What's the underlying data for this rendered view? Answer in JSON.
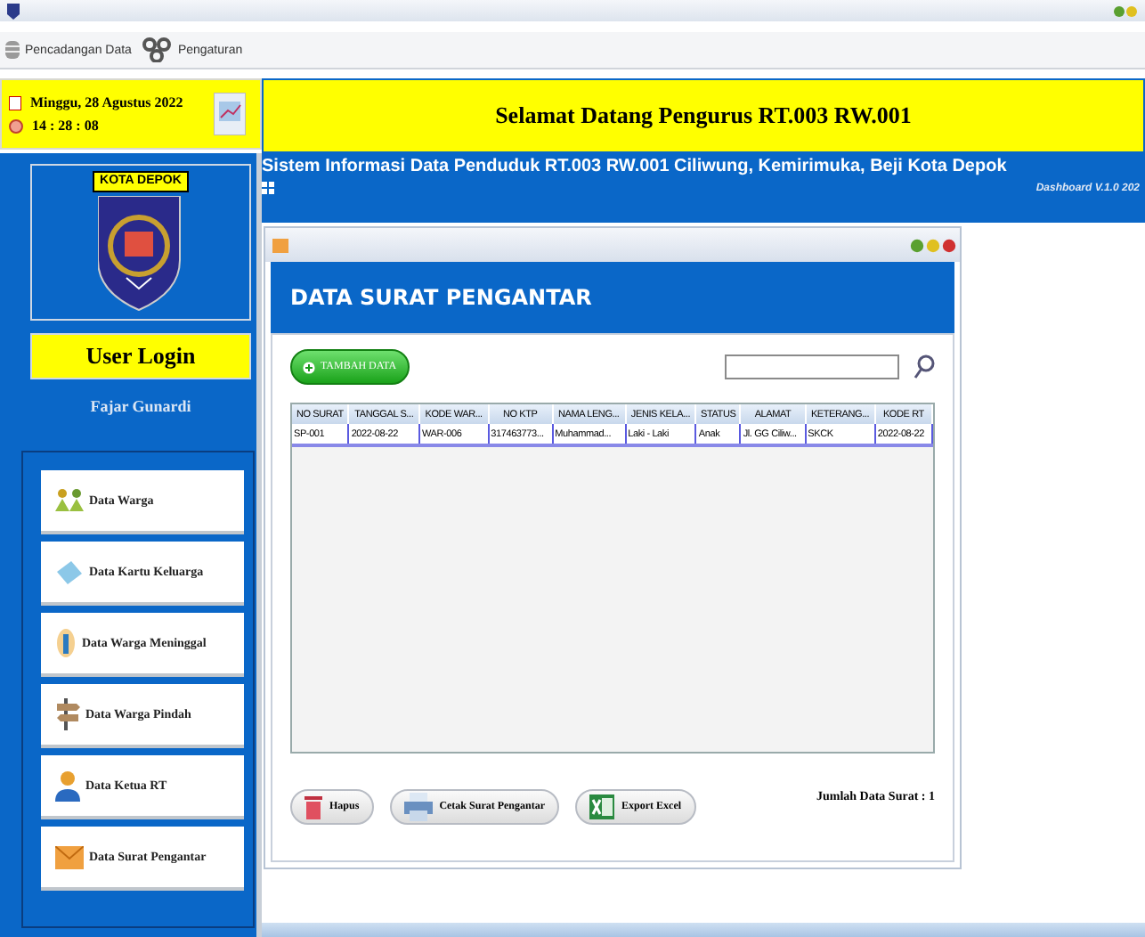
{
  "menu": [
    {
      "label": "Pencadangan Data",
      "kind": "database"
    },
    {
      "label": "Pengaturan",
      "kind": "gears"
    }
  ],
  "clock": {
    "date": "Minggu, 28 Agustus 2022",
    "time": "14 : 28 : 08"
  },
  "header": {
    "greeting": "Selamat Datang Pengurus RT.003 RW.001",
    "subtitle": "Sistem Informasi Data Penduduk RT.003 RW.001 Ciliwung, Kemirimuka, Beji Kota Depok",
    "version": "Dashboard V.1.0 202"
  },
  "logo": {
    "label": "KOTA DEPOK"
  },
  "user": {
    "heading": "User Login",
    "name": "Fajar Gunardi"
  },
  "nav": [
    {
      "label": "Data Warga",
      "kind": "people"
    },
    {
      "label": "Data Kartu Keluarga",
      "kind": "card"
    },
    {
      "label": "Data Warga Meninggal",
      "kind": "candle"
    },
    {
      "label": "Data Warga Pindah",
      "kind": "signpost"
    },
    {
      "label": "Data Ketua RT",
      "kind": "person"
    },
    {
      "label": "Data Surat Pengantar",
      "kind": "envelope"
    }
  ],
  "form": {
    "title": "DATA SURAT PENGANTAR",
    "add_button": "TAMBAH DATA",
    "table": {
      "columns": [
        "NO SURAT",
        "TANGGAL S...",
        "KODE WAR...",
        "NO KTP",
        "NAMA LENG...",
        "JENIS KELA...",
        "STATUS",
        "ALAMAT",
        "KETERANG...",
        "KODE RT"
      ],
      "rows": [
        [
          "SP-001",
          "2022-08-22",
          "WAR-006",
          "317463773...",
          "Muhammad...",
          "Laki - Laki",
          "Anak",
          "Jl. GG Ciliw...",
          "SKCK",
          "2022-08-22"
        ]
      ]
    },
    "buttons": [
      {
        "label": "Hapus",
        "kind": "trash"
      },
      {
        "label": "Cetak Surat Pengantar",
        "kind": "printer"
      },
      {
        "label": "Export Excel",
        "kind": "excel"
      }
    ],
    "count": "Jumlah Data Surat : 1"
  }
}
